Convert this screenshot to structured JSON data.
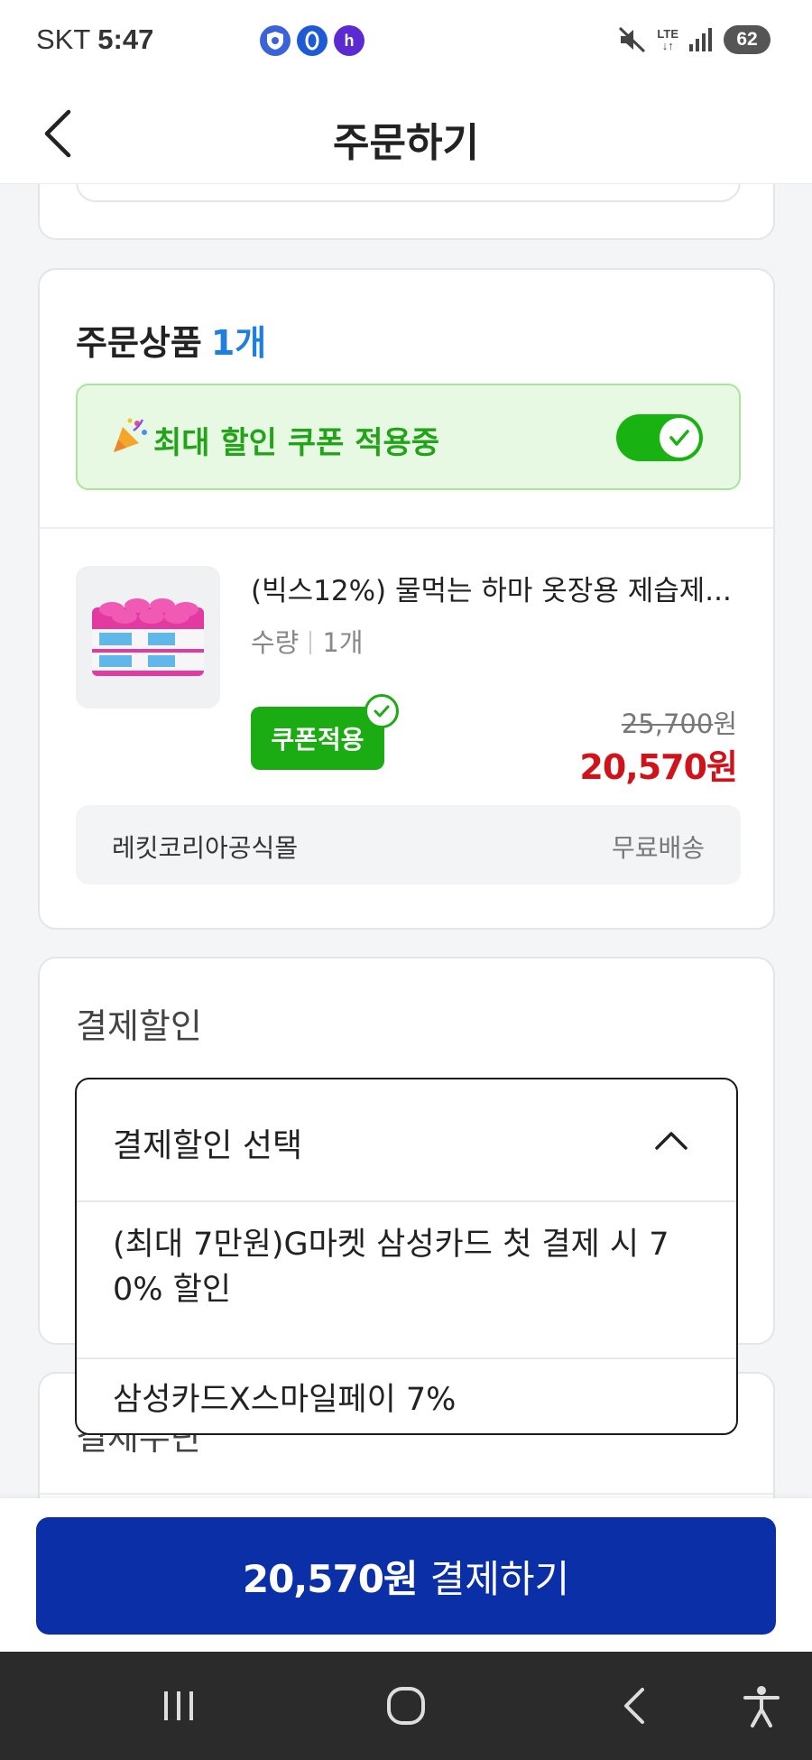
{
  "status_bar": {
    "carrier": "SKT",
    "time": "5:47",
    "network": "LTE",
    "battery": "62"
  },
  "header": {
    "title": "주문하기"
  },
  "order": {
    "title": "주문상품",
    "count": "1개",
    "coupon_banner_text": "최대 할인 쿠폰 적용중",
    "coupon_toggle_on": true,
    "product": {
      "name": "(빅스12%) 물먹는 하마 옷장용 제습제...",
      "qty_label": "수량",
      "qty_value": "1개",
      "coupon_badge": "쿠폰적용",
      "original_price": "25,700",
      "original_unit": "원",
      "final_price": "20,570원"
    },
    "seller": "레킷코리아공식몰",
    "shipping": "무료배송"
  },
  "payment_discount": {
    "title": "결제할인",
    "select_label": "결제할인 선택",
    "options": [
      "(최대 7만원)G마켓 삼성카드 첫 결제 시 70% 할인",
      "삼성카드X스마일페이 7%"
    ]
  },
  "next_section": {
    "title": "결제수단"
  },
  "pay_button": {
    "amount": "20,570원",
    "label": "결제하기"
  },
  "colors": {
    "accent_blue": "#1e7fe0",
    "coupon_green": "#1aac12",
    "price_red": "#d0131b",
    "pay_button_navy": "#0b2fa6"
  }
}
